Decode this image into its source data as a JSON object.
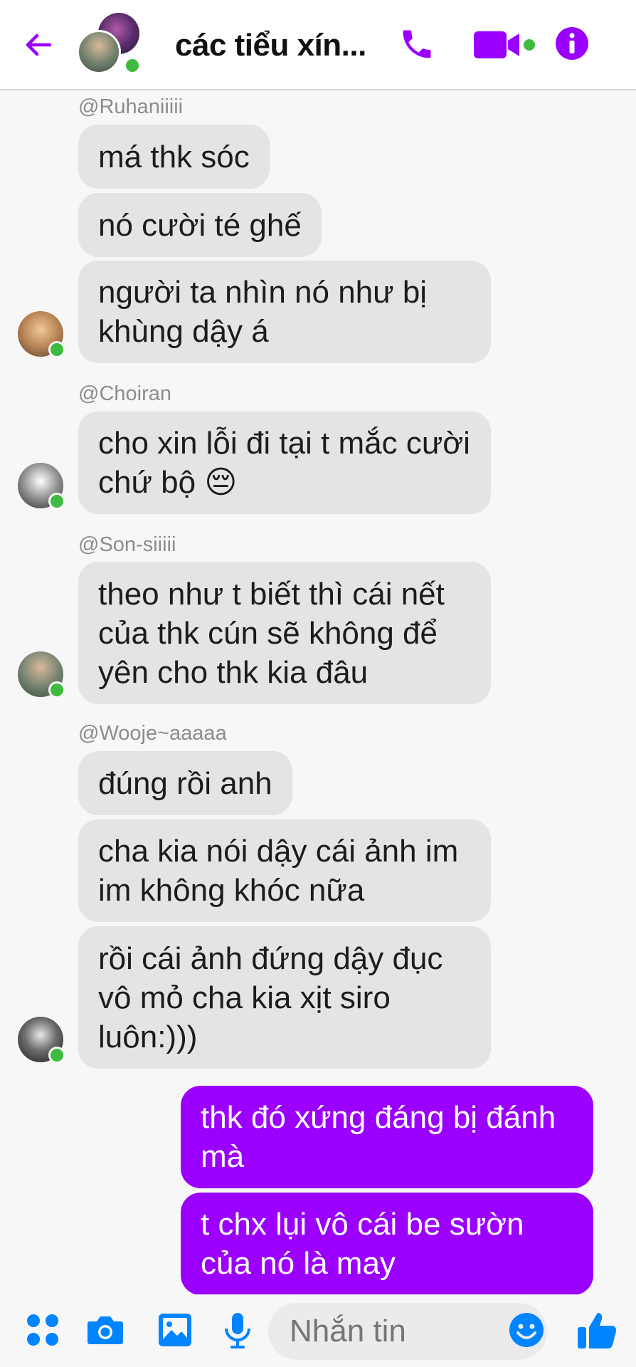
{
  "header": {
    "title": "các tiểu xín...",
    "accent": "#9b00ff"
  },
  "messages": [
    {
      "sender": "@Ruhaniiiii",
      "bubbles": [
        "má thk sóc",
        "nó cười té ghế",
        "người ta nhìn nó như bị khùng dậy á"
      ]
    },
    {
      "sender": "@Choiran",
      "bubbles": [
        "cho xin lỗi đi tại t mắc cười chứ bộ 😔"
      ]
    },
    {
      "sender": "@Son-siiiii",
      "bubbles": [
        "theo như t biết thì cái nết của thk cún sẽ không để yên cho thk kia đâu"
      ]
    },
    {
      "sender": "@Wooje~aaaaa",
      "bubbles": [
        "đúng rồi anh",
        "cha kia nói dậy cái ảnh im im không khóc nữa",
        "rồi cái ảnh đứng dậy đục vô mỏ cha kia xịt siro luôn:)))"
      ]
    }
  ],
  "outgoing": [
    "thk đó xứng đáng bị đánh mà",
    "t chx lụi vô cái be sườn của nó là may"
  ],
  "composer": {
    "placeholder": "Nhắn tin"
  }
}
